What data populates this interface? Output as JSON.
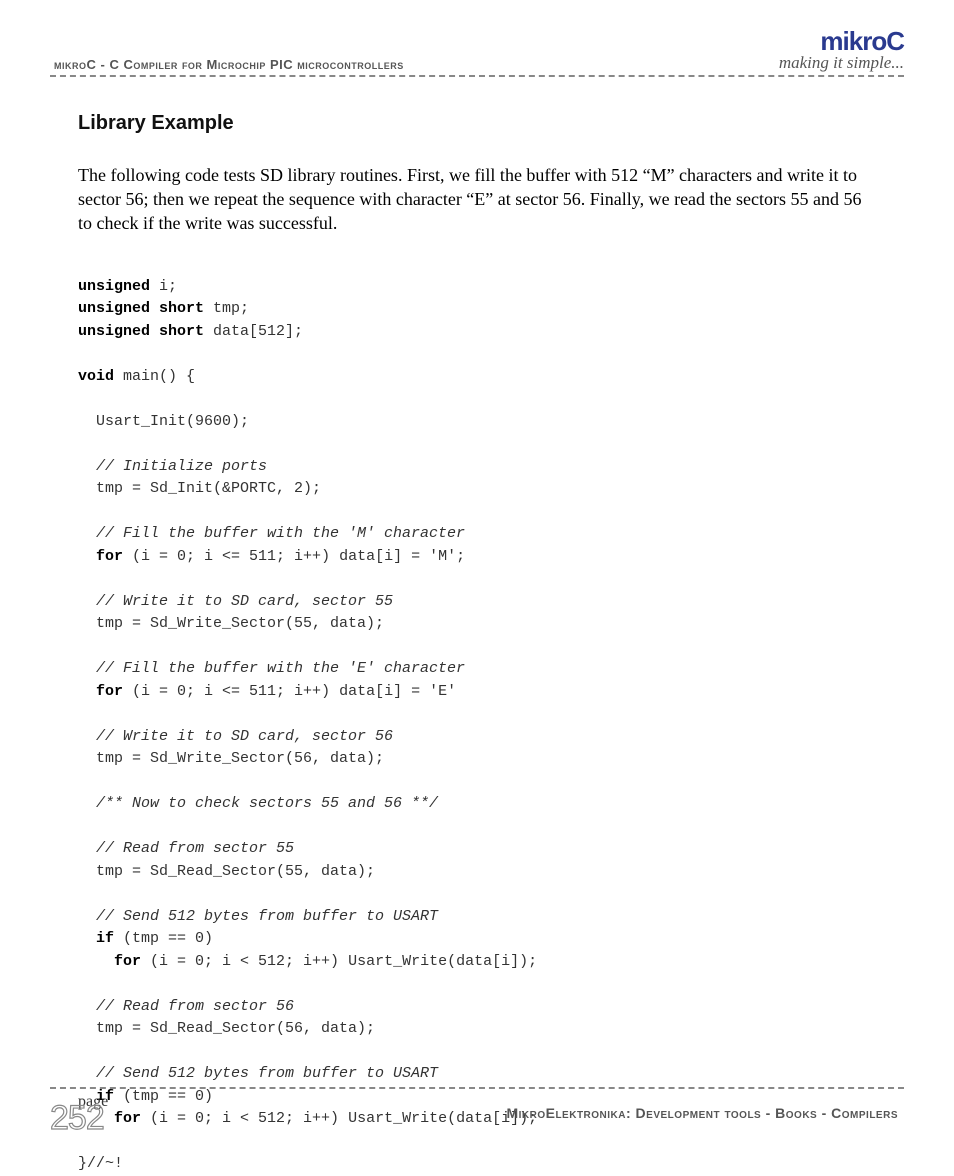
{
  "header": {
    "left": "mikroC - C Compiler for Microchip PIC microcontrollers",
    "logo": "mikroC",
    "tagline": "making it simple..."
  },
  "section_title": "Library Example",
  "intro": "The following code tests SD library routines. First, we fill the buffer with 512 “M” characters and write it to sector 56; then we repeat the sequence with character “E” at sector 56. Finally, we read the sectors 55 and 56 to check if the write was successful.",
  "code": {
    "l1a": "unsigned",
    "l1b": " i;",
    "l2a": "unsigned short",
    "l2b": " tmp;",
    "l3a": "unsigned short",
    "l3b": " data[512];",
    "l4a": "void",
    "l4b": " main() {",
    "l5": "  Usart_Init(9600);",
    "c1": "  // Initialize ports",
    "l6": "  tmp = Sd_Init(&PORTC, 2);",
    "c2": "  // Fill the buffer with the 'M' character",
    "l7a": "  ",
    "l7b": "for",
    "l7c": " (i = 0; i <= 511; i++) data[i] = 'M';",
    "c3": "  // Write it to SD card, sector 55",
    "l8": "  tmp = Sd_Write_Sector(55, data);",
    "c4": "  // Fill the buffer with the 'E' character",
    "l9a": "  ",
    "l9b": "for",
    "l9c": " (i = 0; i <= 511; i++) data[i] = 'E'",
    "c5": "  // Write it to SD card, sector 56",
    "l10": "  tmp = Sd_Write_Sector(56, data);",
    "c6": "  /** Now to check sectors 55 and 56 **/",
    "c7": "  // Read from sector 55",
    "l11": "  tmp = Sd_Read_Sector(55, data);",
    "c8": "  // Send 512 bytes from buffer to USART",
    "l12a": "  ",
    "l12b": "if",
    "l12c": " (tmp == 0)",
    "l13a": "    ",
    "l13b": "for",
    "l13c": " (i = 0; i < 512; i++) Usart_Write(data[i]);",
    "c9": "  // Read from sector 56",
    "l14": "  tmp = Sd_Read_Sector(56, data);",
    "c10": "  // Send 512 bytes from buffer to USART",
    "l15a": "  ",
    "l15b": "if",
    "l15c": " (tmp == 0)",
    "l16a": "    ",
    "l16b": "for",
    "l16c": " (i = 0; i < 512; i++) Usart_Write(data[i]);",
    "l17": "}//~!"
  },
  "footer": {
    "page_label": "page",
    "text": "MikroElektronika: Development tools - Books - Compilers",
    "page_number": "252"
  }
}
